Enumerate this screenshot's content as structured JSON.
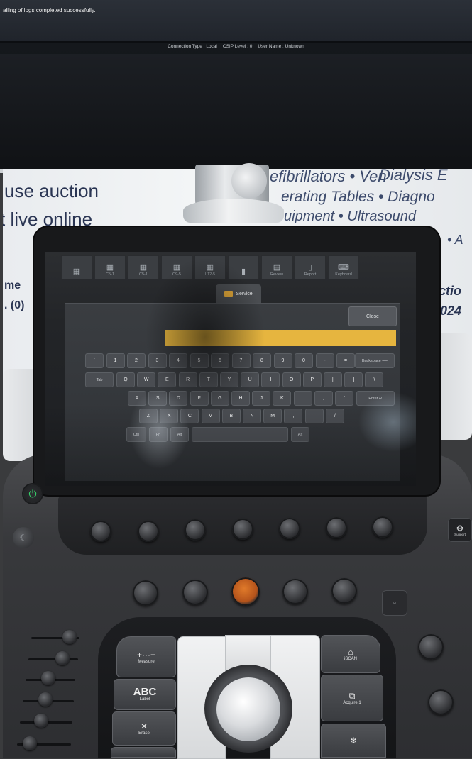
{
  "monitor": {
    "status_message": "alling of logs completed successfully.",
    "info_bar": [
      {
        "label": "Connection Type",
        "value": "Local"
      },
      {
        "label": "CSIP Level",
        "value": "0"
      },
      {
        "label": "User Name",
        "value": "Unknown"
      }
    ]
  },
  "banner": {
    "left_line1": "use auction",
    "left_line2": "t live online",
    "right_line1": "Dialysis  E",
    "right_line2": "efibrillators  •  Ven",
    "right_line3": "erating Tables • Diagno",
    "right_line4": "uipment  •  Ultrasound",
    "right_line5": "• A",
    "frag_left1": "me",
    "frag_left2": ". (0)",
    "frag_right1": "ctio",
    "frag_right2": "024"
  },
  "touchscreen": {
    "top_tabs": [
      {
        "icon": "grid-icon",
        "label": ""
      },
      {
        "icon": "grid-icon",
        "label": "C5-1"
      },
      {
        "icon": "grid-icon",
        "label": "C5-1"
      },
      {
        "icon": "grid-icon",
        "label": "C9-5"
      },
      {
        "icon": "grid-icon",
        "label": "L12-5"
      },
      {
        "icon": "probe-icon",
        "label": ""
      },
      {
        "icon": "review-icon",
        "label": "Review"
      },
      {
        "icon": "report-icon",
        "label": "Report"
      },
      {
        "icon": "keyboard-icon",
        "label": "Keyboard"
      }
    ],
    "active_tab_label": "Service",
    "close_label": "Close",
    "search_value": "",
    "keyboard": {
      "row1": [
        "`",
        "1",
        "2",
        "3",
        "4",
        "5",
        "6",
        "7",
        "8",
        "9",
        "0",
        "-",
        "="
      ],
      "backspace": "Backspace ⟵",
      "tab": "Tab",
      "row2": [
        "Q",
        "W",
        "E",
        "R",
        "T",
        "Y",
        "U",
        "I",
        "O",
        "P",
        "[",
        "]",
        "\\"
      ],
      "row3": [
        "A",
        "S",
        "D",
        "F",
        "G",
        "H",
        "J",
        "K",
        "L",
        ";",
        "'"
      ],
      "enter": "Enter ↵",
      "row4": [
        "Z",
        "X",
        "C",
        "V",
        "B",
        "N",
        "M",
        ",",
        ".",
        "/"
      ],
      "ctrl": "Ctrl",
      "fn": "Fn",
      "alt": "Alt",
      "alt_right": "Alt"
    }
  },
  "console": {
    "support_label": "Support",
    "measure_label": "Measure",
    "label_label": "Label",
    "label_icon_text": "ABC",
    "erase_label": "Erase",
    "iscan_label": "iSCAN",
    "acquire_label": "Acquire 1",
    "measure_glyph": "+···+",
    "erase_glyph": "✕",
    "freeze_glyph": "❄",
    "power_glyph": "⏻"
  }
}
